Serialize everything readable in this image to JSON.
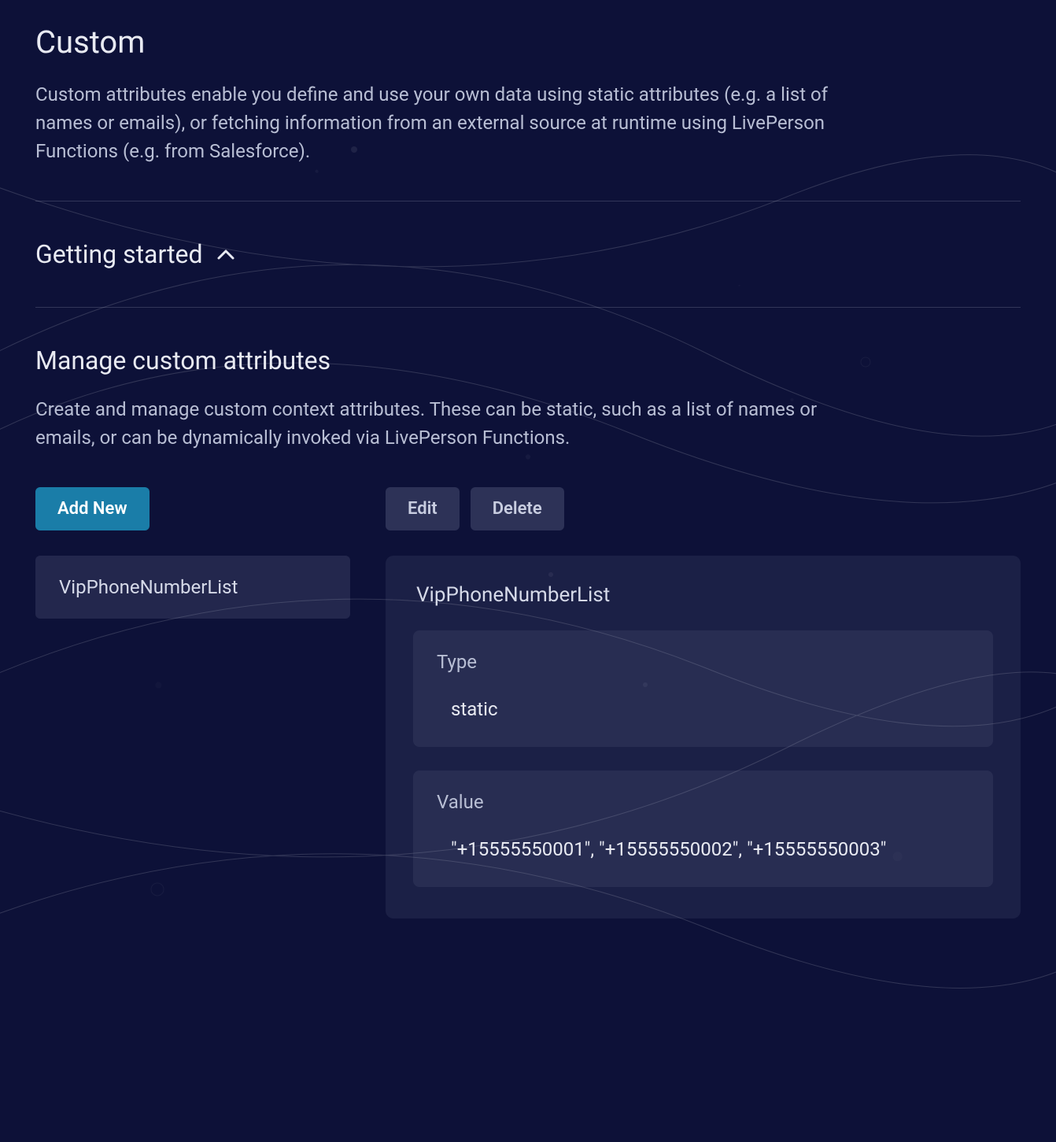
{
  "header": {
    "title": "Custom",
    "description": "Custom attributes enable you define and use your own data using static attributes (e.g. a list of names or emails), or fetching information from an external source at runtime using LivePerson Functions (e.g. from Salesforce)."
  },
  "getting_started": {
    "title": "Getting started"
  },
  "manage": {
    "title": "Manage custom attributes",
    "description": "Create and manage custom context attributes. These can be static, such as a list of names or emails, or can be dynamically invoked via LivePerson Functions.",
    "buttons": {
      "add_new": "Add New",
      "edit": "Edit",
      "delete": "Delete"
    },
    "attributes": [
      {
        "name": "VipPhoneNumberList"
      }
    ],
    "selected": {
      "name": "VipPhoneNumberList",
      "type_label": "Type",
      "type_value": "static",
      "value_label": "Value",
      "value_value": "\"+15555550001\", \"+15555550002\", \"+15555550003\""
    }
  }
}
